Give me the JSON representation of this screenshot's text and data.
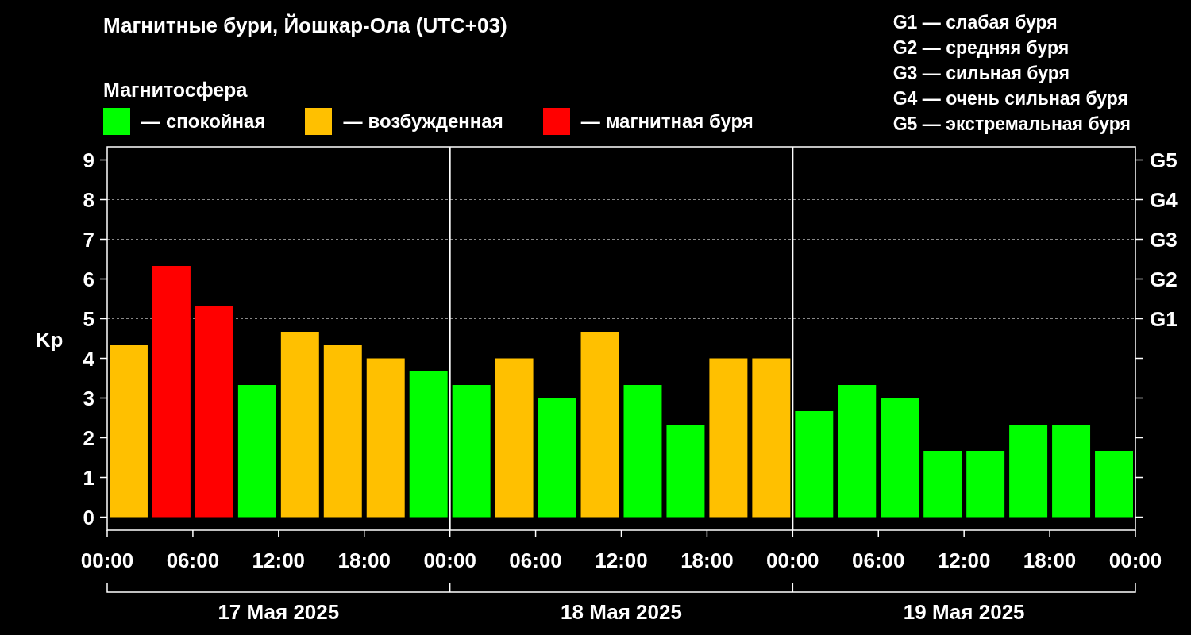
{
  "title": "Магнитные бури, Йошкар-Ола (UTC+03)",
  "legend": {
    "heading": "Магнитосфера",
    "dashes": [
      "—",
      "—",
      "—"
    ]
  },
  "storm_scale": [
    "G1 — слабая буря",
    "G2 — средняя буря",
    "G3 — сильная буря",
    "G4 — очень сильная буря",
    "G5 — экстремальная буря"
  ],
  "chart": {
    "g_axis": [
      "G5",
      "G4",
      "G3",
      "G2",
      "G1"
    ],
    "days": [
      "17 Мая 2025",
      "18 Мая 2025",
      "19 Мая 2025"
    ],
    "chart_data": {
      "type": "bar",
      "ylabel": "Kp",
      "stacked": true,
      "grid": true,
      "x": [
        "2025-05-17T01:30",
        "2025-05-17T04:30",
        "2025-05-17T07:30",
        "2025-05-17T10:30",
        "2025-05-17T13:30",
        "2025-05-17T16:30",
        "2025-05-17T19:30",
        "2025-05-17T22:30",
        "2025-05-18T01:30",
        "2025-05-18T04:30",
        "2025-05-18T07:30",
        "2025-05-18T10:30",
        "2025-05-18T13:30",
        "2025-05-18T16:30",
        "2025-05-18T19:30",
        "2025-05-18T22:30",
        "2025-05-19T01:30",
        "2025-05-19T04:30",
        "2025-05-19T07:30",
        "2025-05-19T10:30",
        "2025-05-19T13:30",
        "2025-05-19T16:30",
        "2025-05-19T19:30",
        "2025-05-19T22:30"
      ],
      "series": [
        {
          "name": "спокойная",
          "color": "#00ff00",
          "values": [
            null,
            null,
            null,
            3.33,
            null,
            null,
            null,
            3.67,
            3.33,
            null,
            3.0,
            null,
            3.33,
            2.33,
            null,
            null,
            2.67,
            3.33,
            3.0,
            1.67,
            1.67,
            2.33,
            2.33,
            1.67
          ]
        },
        {
          "name": "возбужденная",
          "color": "#ffc000",
          "values": [
            4.33,
            null,
            null,
            null,
            4.67,
            4.33,
            4.0,
            null,
            null,
            4.0,
            null,
            4.67,
            null,
            null,
            4.0,
            4.0,
            null,
            null,
            null,
            null,
            null,
            null,
            null,
            null
          ]
        },
        {
          "name": "магнитная буря",
          "color": "#ff0000",
          "values": [
            null,
            6.33,
            5.33,
            null,
            null,
            null,
            null,
            null,
            null,
            null,
            null,
            null,
            null,
            null,
            null,
            null,
            null,
            null,
            null,
            null,
            null,
            null,
            null,
            null
          ]
        }
      ],
      "xlim": [
        "2025-05-17T00:00",
        "2025-05-20T00:00"
      ],
      "ylim": [
        -0.33,
        9.33
      ],
      "xticks": [
        {
          "value": "2025-05-17T00:00",
          "label": "00:00"
        },
        {
          "value": "2025-05-17T06:00",
          "label": "06:00"
        },
        {
          "value": "2025-05-17T12:00",
          "label": "12:00"
        },
        {
          "value": "2025-05-17T18:00",
          "label": "18:00"
        },
        {
          "value": "2025-05-18T00:00",
          "label": "00:00"
        },
        {
          "value": "2025-05-18T06:00",
          "label": "06:00"
        },
        {
          "value": "2025-05-18T12:00",
          "label": "12:00"
        },
        {
          "value": "2025-05-18T18:00",
          "label": "18:00"
        },
        {
          "value": "2025-05-19T00:00",
          "label": "00:00"
        },
        {
          "value": "2025-05-19T06:00",
          "label": "06:00"
        },
        {
          "value": "2025-05-19T12:00",
          "label": "12:00"
        },
        {
          "value": "2025-05-19T18:00",
          "label": "18:00"
        },
        {
          "value": "2025-05-20T00:00",
          "label": "00:00"
        }
      ],
      "yticks": [
        0,
        1,
        2,
        3,
        4,
        5,
        6,
        7,
        8,
        9
      ]
    }
  }
}
